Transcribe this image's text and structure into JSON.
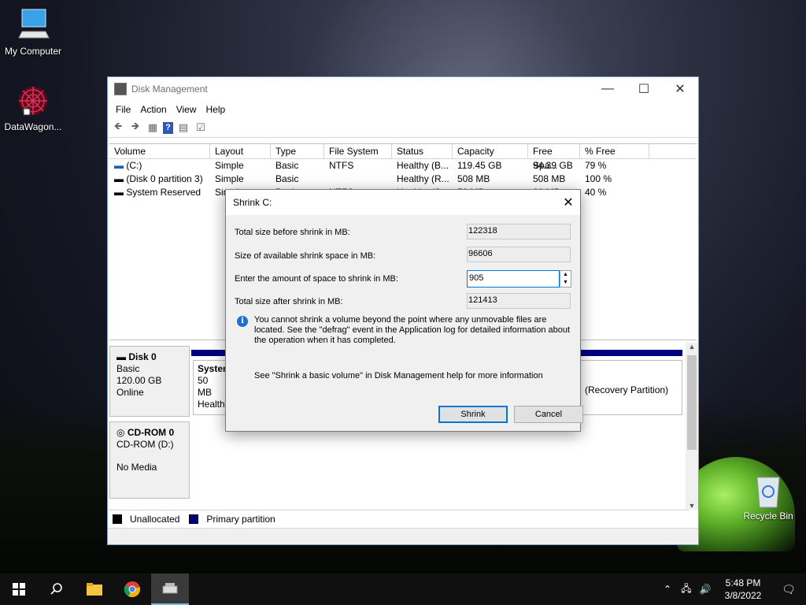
{
  "desktop": {
    "icons": [
      {
        "label": "My Computer",
        "icon": "computer-monitor-icon"
      },
      {
        "label": "DataWagon...",
        "icon": "datawagon-logo-icon"
      },
      {
        "label": "Recycle Bin",
        "icon": "recycle-bin-icon"
      }
    ]
  },
  "window": {
    "title": "Disk Management",
    "menu": [
      "File",
      "Action",
      "View",
      "Help"
    ],
    "toolbar": [
      "back-arrow-icon",
      "forward-arrow-icon",
      "console-tree-icon",
      "help-icon",
      "properties-icon",
      "refresh-icon"
    ],
    "columns": [
      "Volume",
      "Layout",
      "Type",
      "File System",
      "Status",
      "Capacity",
      "Free Spa...",
      "% Free"
    ],
    "rows": [
      [
        "(C:)",
        "Simple",
        "Basic",
        "NTFS",
        "Healthy (B...",
        "119.45 GB",
        "94.39 GB",
        "79 %"
      ],
      [
        "(Disk 0 partition 3)",
        "Simple",
        "Basic",
        "",
        "Healthy (R...",
        "508 MB",
        "508 MB",
        "100 %"
      ],
      [
        "System Reserved",
        "Simple",
        "Basic",
        "NTFS",
        "Healthy (S...",
        "50 MB",
        "20 MB",
        "40 %"
      ]
    ],
    "disk0": {
      "name": "Disk 0",
      "type": "Basic",
      "size": "120.00 GB",
      "state": "Online"
    },
    "disk0_parts": {
      "p1_name": "System",
      "p1_size": "50 MB",
      "p1_status": "Healthy",
      "p3_status": "(Recovery Partition)"
    },
    "cdrom": {
      "name": "CD-ROM 0",
      "type": "CD-ROM (D:)",
      "media": "No Media"
    },
    "legend": {
      "unallocated": "Unallocated",
      "primary": "Primary partition"
    }
  },
  "dialog": {
    "title": "Shrink C:",
    "total_before_label": "Total size before shrink in MB:",
    "total_before_value": "122318",
    "available_label": "Size of available shrink space in MB:",
    "available_value": "96606",
    "amount_label": "Enter the amount of space to shrink in MB:",
    "amount_value": "905",
    "after_label": "Total size after shrink in MB:",
    "after_value": "121413",
    "info": "You cannot shrink a volume beyond the point where any unmovable files are located. See the \"defrag\" event in the Application log for detailed information about the operation when it has completed.",
    "help": "See \"Shrink a basic volume\" in Disk Management help for more information",
    "shrink_button": "Shrink",
    "cancel_button": "Cancel"
  },
  "taskbar": {
    "time": "5:48 PM",
    "date": "3/8/2022"
  },
  "colors": {
    "primary_partition": "#000080",
    "accent": "#0078d7"
  }
}
